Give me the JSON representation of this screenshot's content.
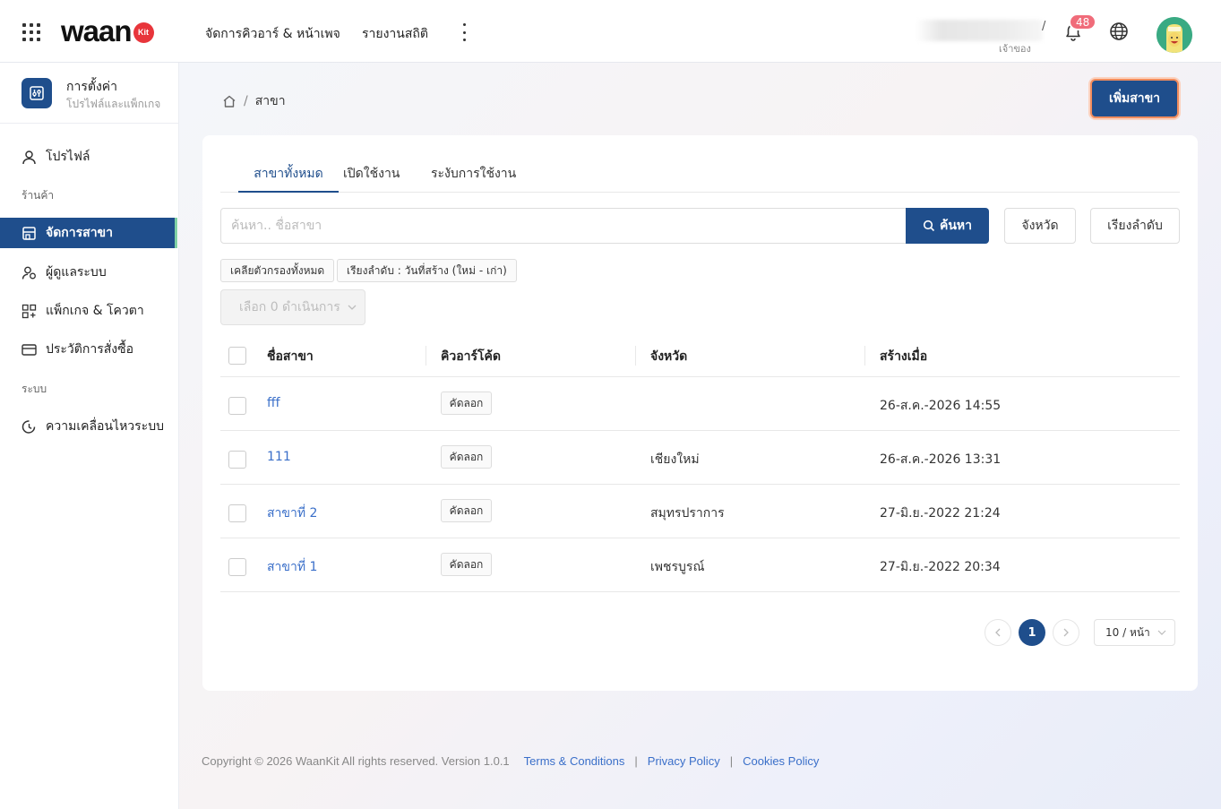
{
  "header": {
    "logo_text": "waan",
    "logo_badge": "Kit",
    "nav": [
      "จัดการคิวอาร์ & หน้าเพจ",
      "รายงานสถิติ"
    ],
    "user_role": "เจ้าของ",
    "user_slash": "/",
    "notification_count": "48"
  },
  "sidebar": {
    "title": "การตั้งค่า",
    "subtitle": "โปรไฟล์และแพ็กเกจ",
    "profile": "โปรไฟล์",
    "section_shop": "ร้านค้า",
    "branches": "จัดการสาขา",
    "users": "ผู้ดูแลระบบ",
    "packages": "แพ็กเกจ & โควตา",
    "orders": "ประวัติการสั่งซื้อ",
    "section_system": "ระบบ",
    "activity": "ความเคลื่อนไหวระบบ"
  },
  "page": {
    "breadcrumb": "สาขา",
    "breadcrumb_sep": "/",
    "add_button": "เพิ่มสาขา"
  },
  "tabs": [
    "สาขาทั้งหมด",
    "เปิดใช้งาน",
    "ระงับการใช้งาน"
  ],
  "search": {
    "placeholder": "ค้นหา.. ชื่อสาขา",
    "button": "ค้นหา",
    "province_button": "จังหวัด",
    "sort_button": "เรียงลำดับ"
  },
  "filters": {
    "clear": "เคลียตัวกรองทั้งหมด",
    "sort": "เรียงลำดับ : วันที่สร้าง (ใหม่ - เก่า)"
  },
  "bulk_action": "เลือก 0 ดำเนินการ",
  "table": {
    "columns": [
      "ชื่อสาขา",
      "คิวอาร์โค้ด",
      "จังหวัด",
      "สร้างเมื่อ"
    ],
    "copy_label": "คัดลอก",
    "rows": [
      {
        "name": "fff",
        "province": "",
        "created": "26-ส.ค.-2026 14:55"
      },
      {
        "name": "111",
        "province": "เชียงใหม่",
        "created": "26-ส.ค.-2026 13:31"
      },
      {
        "name": "สาขาที่ 2",
        "province": "สมุทรปราการ",
        "created": "27-มิ.ย.-2022 21:24"
      },
      {
        "name": "สาขาที่ 1",
        "province": "เพชรบูรณ์",
        "created": "27-มิ.ย.-2022 20:34"
      }
    ]
  },
  "pagination": {
    "current": "1",
    "page_size": "10 / หน้า"
  },
  "footer": {
    "copyright": "Copyright © 2026 WaanKit All rights reserved. Version 1.0.1",
    "sep": "|",
    "terms": "Terms & Conditions",
    "privacy": "Privacy Policy",
    "cookies": "Cookies Policy"
  },
  "colors": {
    "primary": "#1f4e8c",
    "link": "#3a6fc9",
    "badge": "#f06c7a",
    "brand_red": "#e8353b"
  },
  "icons": [
    "apps-grid-icon",
    "bell-icon",
    "globe-icon",
    "settings-sliders-icon",
    "user-icon",
    "store-icon",
    "users-icon",
    "package-grid-icon",
    "credit-card-icon",
    "history-clock-icon",
    "home-icon",
    "search-icon",
    "chevron-down-icon",
    "chevron-left-icon",
    "chevron-right-icon"
  ]
}
